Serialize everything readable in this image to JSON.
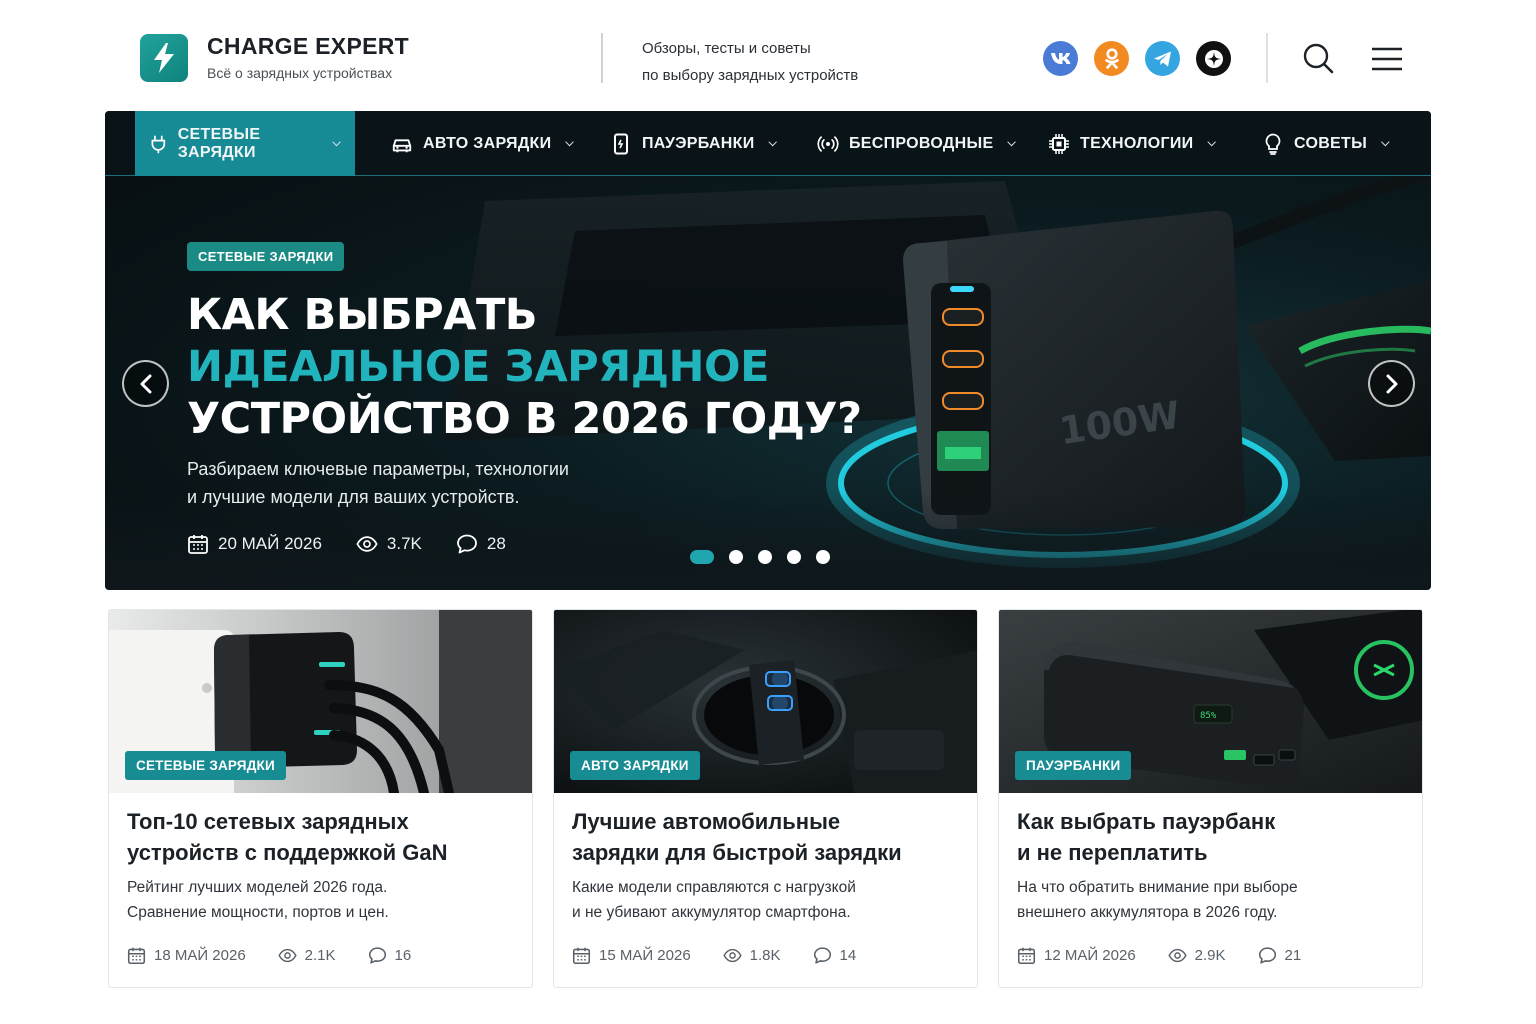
{
  "brand": {
    "name": "CHARGE EXPERT",
    "subtitle": "Всё о зарядных устройствах",
    "tagline": "Обзоры, тесты и советы\nпо выбору зарядных устройств",
    "accent_color": "#168b95"
  },
  "socials": [
    {
      "name": "vk",
      "label": "VK",
      "color": "#4a7bd6"
    },
    {
      "name": "odnoklassniki",
      "label": "ok",
      "color": "#f28a22"
    },
    {
      "name": "telegram",
      "label": "tg",
      "color": "#35a5e2"
    },
    {
      "name": "dzen",
      "label": "dzen",
      "color": "#111111"
    }
  ],
  "nav": {
    "items": [
      {
        "label": "СЕТЕВЫЕ ЗАРЯДКИ",
        "icon": "plug-icon",
        "active": true
      },
      {
        "label": "АВТО ЗАРЯДКИ",
        "icon": "car-icon",
        "active": false
      },
      {
        "label": "ПАУЭРБАНКИ",
        "icon": "powerbank-icon",
        "active": false
      },
      {
        "label": "БЕСПРОВОДНЫЕ",
        "icon": "wireless-icon",
        "active": false
      },
      {
        "label": "ТЕХНОЛОГИИ",
        "icon": "chip-icon",
        "active": false
      },
      {
        "label": "СОВЕТЫ",
        "icon": "lightbulb-icon",
        "active": false
      }
    ]
  },
  "hero": {
    "badge": "СЕТЕВЫЕ ЗАРЯДКИ",
    "title_line1": "КАК ВЫБРАТЬ",
    "title_accent": "ИДЕАЛЬНОЕ ЗАРЯДНОЕ",
    "title_line3": "УСТРОЙСТВО В 2026 ГОДУ?",
    "description": "Разбираем ключевые параметры, технологии\nи лучшие модели для ваших устройств.",
    "date": "20 МАЙ 2026",
    "views": "3.7K",
    "comments": "28",
    "charger_label": "100W",
    "slides_total": 5,
    "slide_active": 1
  },
  "cards": [
    {
      "badge": "СЕТЕВЫЕ ЗАРЯДКИ",
      "title": "Топ-10 сетевых зарядных\nустройств с поддержкой GaN",
      "description": "Рейтинг лучших моделей 2026 года.\nСравнение мощности, портов и цен.",
      "date": "18 МАЙ 2026",
      "views": "2.1K",
      "comments": "16"
    },
    {
      "badge": "АВТО ЗАРЯДКИ",
      "title": "Лучшие автомобильные\nзарядки для быстрой зарядки",
      "description": "Какие модели справляются с нагрузкой\nи не убивают аккумулятор смартфона.",
      "date": "15 МАЙ 2026",
      "views": "1.8K",
      "comments": "14"
    },
    {
      "badge": "ПАУЭРБАНКИ",
      "title": "Как выбрать пауэрбанк\nи не переплатить",
      "description": "На что обратить внимание при выборе\nвнешнего аккумулятора в 2026 году.",
      "date": "12 МАЙ 2026",
      "views": "2.9K",
      "comments": "21"
    }
  ]
}
